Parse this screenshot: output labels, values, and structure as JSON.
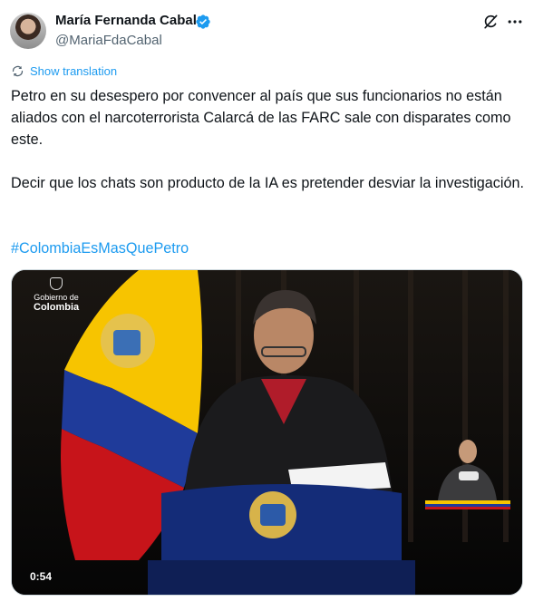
{
  "author": {
    "display_name": "María Fernanda Cabal",
    "handle": "@MariaFdaCabal",
    "verified": true
  },
  "actions": {
    "grok_icon": "grok-icon",
    "more_icon": "more-icon"
  },
  "translation": {
    "label": "Show translation"
  },
  "tweet": {
    "paragraph_1": "Petro en su desespero por convencer al país que sus funcionarios no están aliados con el narcoterrorista Calarcá de las FARC sale con disparates como este.",
    "paragraph_2": "Decir que los chats son producto de la IA es pretender desviar la investigación.",
    "hashtag": "#ColombiaEsMasQuePetro"
  },
  "video": {
    "logo_line_1": "Gobierno de",
    "logo_line_2": "Colombia",
    "duration": "0:54"
  },
  "colors": {
    "accent": "#1d9bf0",
    "text": "#0f1419",
    "secondary": "#536471"
  }
}
